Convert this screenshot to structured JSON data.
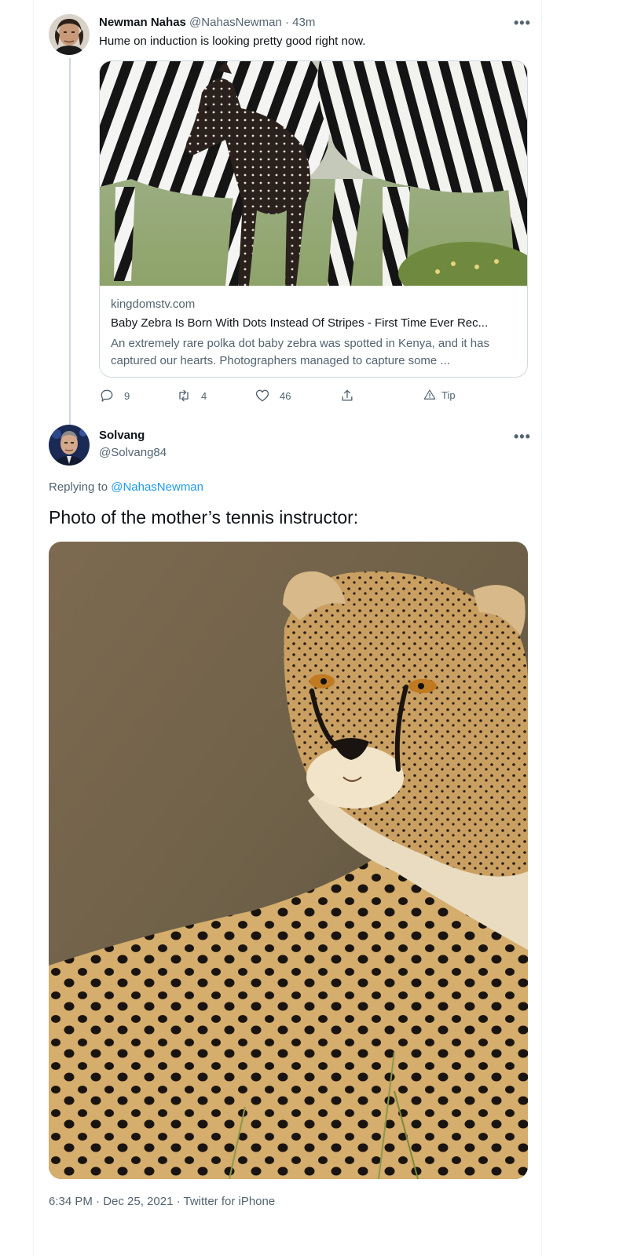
{
  "tweet1": {
    "author_name": "Newman Nahas",
    "author_handle": "@NahasNewman",
    "separator": "·",
    "time": "43m",
    "text": "Hume on induction is looking pretty good right now.",
    "more_icon": "more-icon",
    "link_card": {
      "domain": "kingdomstv.com",
      "title": "Baby Zebra Is Born With Dots Instead Of Stripes - First Time Ever Rec...",
      "description": "An extremely rare polka dot baby zebra was spotted in Kenya, and it has captured our hearts. Photographers managed to capture some ..."
    },
    "actions": {
      "reply_count": "9",
      "retweet_count": "4",
      "like_count": "46",
      "tip_label": "Tip"
    }
  },
  "tweet2": {
    "author_name": "Solvang",
    "author_handle": "@Solvang84",
    "replying_label": "Replying to",
    "replying_mention": "@NahasNewman",
    "text": "Photo of the mother’s tennis instructor:",
    "meta": "6:34 PM · Dec 25, 2021 · Twitter for iPhone"
  },
  "colors": {
    "accent": "#1d9bf0",
    "secondary_text": "#536471",
    "border": "#cfd9de"
  }
}
